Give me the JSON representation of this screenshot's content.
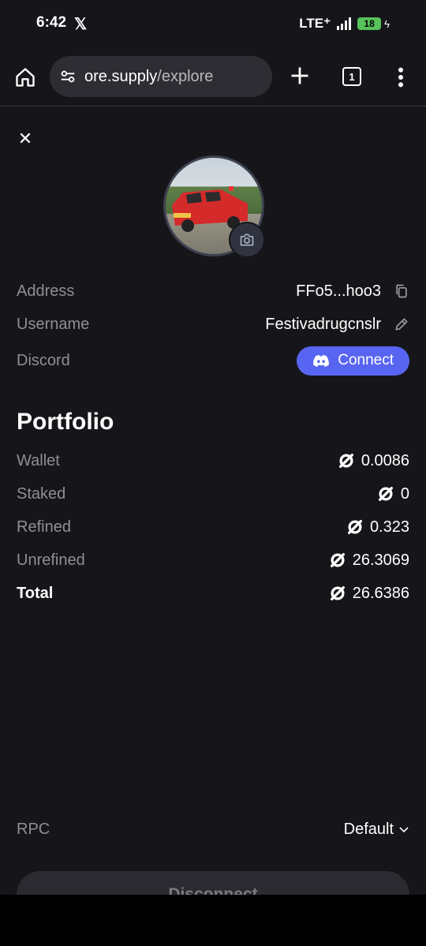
{
  "status_bar": {
    "time": "6:42",
    "app_icon": "x-logo-icon",
    "network": "LTE⁺",
    "battery": "18"
  },
  "browser": {
    "url_host": "ore.supply",
    "url_path": "/explore",
    "tab_count": "1"
  },
  "profile": {
    "rows": {
      "address_label": "Address",
      "address_value": "FFo5...hoo3",
      "username_label": "Username",
      "username_value": "Festivadrugcnslr",
      "discord_label": "Discord",
      "discord_button": "Connect"
    }
  },
  "portfolio": {
    "title": "Portfolio",
    "items": [
      {
        "label": "Wallet",
        "value": "0.0086"
      },
      {
        "label": "Staked",
        "value": "0"
      },
      {
        "label": "Refined",
        "value": "0.323"
      },
      {
        "label": "Unrefined",
        "value": "26.3069"
      },
      {
        "label": "Total",
        "value": "26.6386"
      }
    ]
  },
  "settings": {
    "rpc_label": "RPC",
    "rpc_value": "Default"
  },
  "actions": {
    "disconnect_label": "Disconnect"
  },
  "colors": {
    "background": "#16161a",
    "accent_discord": "#5865f2",
    "muted_text": "#8e8e95"
  }
}
